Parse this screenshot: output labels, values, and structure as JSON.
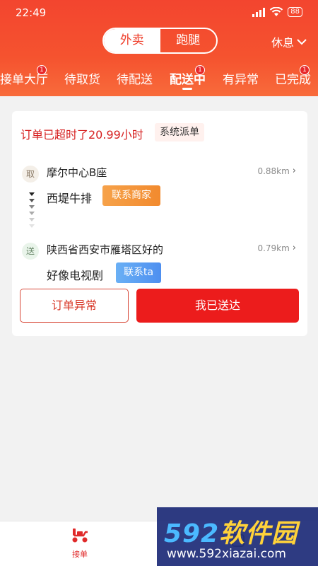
{
  "status_bar": {
    "time": "22:49",
    "battery": "88"
  },
  "header": {
    "mode_tabs": [
      {
        "label": "外卖",
        "active": true
      },
      {
        "label": "跑腿",
        "active": false
      }
    ],
    "rest_label": "休息",
    "order_tabs": [
      {
        "label": "接单大厅",
        "badge": "1"
      },
      {
        "label": "待取货",
        "badge": ""
      },
      {
        "label": "待配送",
        "badge": ""
      },
      {
        "label": "配送中",
        "badge": "1",
        "active": true
      },
      {
        "label": "有异常",
        "badge": ""
      },
      {
        "label": "已完成",
        "badge": "1"
      }
    ]
  },
  "order": {
    "overtime_text": "订单已超时了20.99小时",
    "dispatch_tag": "系统派单",
    "pickup": {
      "marker": "取",
      "address": "摩尔中心B座",
      "distance": "0.88km",
      "name": "西堤牛排",
      "contact_button": "联系商家"
    },
    "delivery": {
      "marker": "送",
      "address": "陕西省西安市雁塔区好的",
      "distance": "0.79km",
      "name": "好像电视剧",
      "contact_button": "联系ta"
    },
    "exception_button": "订单异常",
    "delivered_button": "我已送达"
  },
  "bottom_nav": {
    "items": [
      {
        "label": "接单",
        "icon": "scooter-icon",
        "active": true
      }
    ]
  },
  "watermark": {
    "logo_main": "592",
    "logo_sub": "软件园",
    "url": "www.592xiazai.com"
  },
  "colors": {
    "primary": "#f3452f",
    "danger": "#ec1c1c",
    "merchant": "#f28a2e",
    "contact": "#4e8ff0"
  }
}
